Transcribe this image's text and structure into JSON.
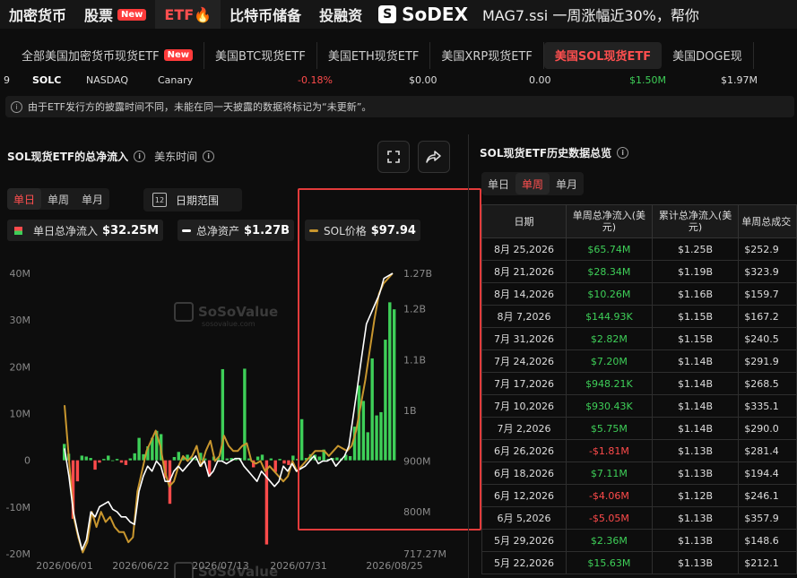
{
  "topnav": {
    "items": [
      {
        "label": "加密货币"
      },
      {
        "label": "股票",
        "badge": "New"
      },
      {
        "label": "ETF🔥",
        "active": true
      },
      {
        "label": "比特币储备"
      },
      {
        "label": "投融资"
      }
    ],
    "brand": "SoDEX",
    "ticker": "MAG7.ssi 一周涨幅近30%，帮你"
  },
  "subnav": {
    "tabs": [
      {
        "label": "全部美国加密货币现货ETF",
        "badge": "New"
      },
      {
        "label": "美国BTC现货ETF"
      },
      {
        "label": "美国ETH现货ETF"
      },
      {
        "label": "美国XRP现货ETF"
      },
      {
        "label": "美国SOL现货ETF",
        "active": true
      },
      {
        "label": "美国DOGE现"
      }
    ]
  },
  "etf_row": {
    "index": "9",
    "ticker": "SOLC",
    "exchange": "NASDAQ",
    "issuer": "Canary",
    "change": "-0.18%",
    "val1": "$0.00",
    "val2": "0.00",
    "val3": "$1.50M",
    "val4": "$1.97M"
  },
  "notice": "由于ETF发行方的披露时间不同，未能在同一天披露的数据将标记为“未更新”。",
  "left_panel": {
    "title": "SOL现货ETF的总净流入",
    "timezone": "美东时间",
    "period_tabs": [
      "单日",
      "单周",
      "单月"
    ],
    "active_period": "单日",
    "date_range_label": "日期范围",
    "calendar_day": "12",
    "legend": [
      {
        "label": "单日总净流入",
        "value": "$32.25M"
      },
      {
        "label": "总净资产",
        "value": "$1.27B"
      },
      {
        "label": "SOL价格",
        "value": "$97.94"
      }
    ],
    "watermark": "SoSoValue",
    "watermark_sub": "sosovalue.com"
  },
  "chart_data": {
    "type": "bar",
    "left_axis": {
      "ticks": [
        "40M",
        "30M",
        "20M",
        "10M",
        "0",
        "-10M",
        "-20M"
      ],
      "range": [
        -20,
        40
      ]
    },
    "right_axis": {
      "ticks": [
        "1.27B",
        "1.2B",
        "1.1B",
        "1B",
        "900M",
        "800M",
        "717.27M"
      ],
      "range": [
        717.27,
        1270
      ]
    },
    "x_labels": [
      "2026/06/01",
      "2026/06/22",
      "2026/07/13",
      "2026/07/31",
      "2026/08/25"
    ],
    "colors": {
      "positive": "#3ecf58",
      "negative": "#ff4b4b",
      "net_assets": "#ffffff",
      "sol_price": "#c8962e"
    },
    "series": [
      {
        "name": "单日总净流入",
        "values": [
          3.5,
          1.4,
          -12.5,
          -4.5,
          1.0,
          0.8,
          0.5,
          -2.0,
          -0.5,
          0.3,
          1.0,
          0.0,
          0.3,
          -0.5,
          -1.0,
          0.4,
          1.5,
          4.8,
          1.3,
          3.0,
          4.8,
          6.3,
          5.6,
          -3.8,
          -9.3,
          0.7,
          1.8,
          0.7,
          1.2,
          0.6,
          0.4,
          1.6,
          0.4,
          -3.4,
          0.8,
          0.6,
          19.5,
          0.4,
          0.5,
          0.2,
          0.5,
          19.6,
          0.4,
          -1.5,
          0.8,
          1.2,
          -18.0,
          0.4,
          -2.5,
          0.3,
          -0.7,
          -1.0,
          1.0,
          0.3,
          8.8,
          0.5,
          1.3,
          1.2,
          0.8,
          2.3,
          0.3,
          0.5,
          0.6,
          0.4,
          1.2,
          0.9,
          7.2,
          16.0,
          12.7,
          6.0,
          21.8,
          9.6,
          10.3,
          25.8,
          33.8,
          32.3
        ]
      },
      {
        "name": "总净资产",
        "values": [
          925,
          870,
          800,
          760,
          725,
          745,
          800,
          790,
          810,
          815,
          820,
          805,
          800,
          790,
          790,
          780,
          775,
          840,
          870,
          890,
          880,
          900,
          890,
          860,
          860,
          880,
          890,
          880,
          890,
          900,
          910,
          890,
          900,
          870,
          880,
          900,
          900,
          895,
          900,
          905,
          905,
          890,
          880,
          870,
          860,
          880,
          870,
          860,
          850,
          860,
          890,
          880,
          895,
          880,
          885,
          890,
          900,
          910,
          895,
          900,
          900,
          905,
          890,
          900,
          910,
          930,
          990,
          1050,
          1110,
          1170,
          1190,
          1210,
          1230,
          1260,
          1265,
          1270
        ]
      },
      {
        "name": "SOL价格",
        "values": [
          1010,
          900,
          790,
          750,
          720,
          740,
          800,
          770,
          800,
          780,
          790,
          770,
          760,
          760,
          740,
          750,
          840,
          880,
          920,
          940,
          960,
          930,
          880,
          850,
          860,
          890,
          910,
          900,
          910,
          930,
          890,
          920,
          940,
          900,
          910,
          950,
          930,
          920,
          920,
          930,
          935,
          900,
          895,
          900,
          880,
          890,
          880,
          870,
          860,
          870,
          900,
          880,
          890,
          900,
          910,
          920,
          920,
          920,
          910,
          920,
          930,
          925,
          920,
          930,
          960,
          1010,
          1060,
          1120,
          1180,
          1230,
          1250,
          1260,
          1270
        ]
      }
    ]
  },
  "right_panel": {
    "title": "SOL现货ETF历史数据总览",
    "period_tabs": [
      "单日",
      "单周",
      "单月"
    ],
    "active_period": "单周",
    "columns": [
      "日期",
      "单周总净流入(美元)",
      "累计总净流入(美元)",
      "单周总成交"
    ],
    "rows": [
      {
        "date": "8月 25,2026",
        "flow": "$65.74M",
        "cum": "$1.25B",
        "vol": "$252.9",
        "dir": "pos"
      },
      {
        "date": "8月 21,2026",
        "flow": "$28.34M",
        "cum": "$1.19B",
        "vol": "$323.9",
        "dir": "pos"
      },
      {
        "date": "8月 14,2026",
        "flow": "$10.26M",
        "cum": "$1.16B",
        "vol": "$159.7",
        "dir": "pos"
      },
      {
        "date": "8月 7,2026",
        "flow": "$144.93K",
        "cum": "$1.15B",
        "vol": "$167.2",
        "dir": "pos"
      },
      {
        "date": "7月 31,2026",
        "flow": "$2.82M",
        "cum": "$1.15B",
        "vol": "$240.5",
        "dir": "pos"
      },
      {
        "date": "7月 24,2026",
        "flow": "$7.20M",
        "cum": "$1.14B",
        "vol": "$291.9",
        "dir": "pos"
      },
      {
        "date": "7月 17,2026",
        "flow": "$948.21K",
        "cum": "$1.14B",
        "vol": "$268.5",
        "dir": "pos"
      },
      {
        "date": "7月 10,2026",
        "flow": "$930.43K",
        "cum": "$1.14B",
        "vol": "$335.1",
        "dir": "pos"
      },
      {
        "date": "7月 2,2026",
        "flow": "$5.75M",
        "cum": "$1.14B",
        "vol": "$290.0",
        "dir": "pos"
      },
      {
        "date": "6月 26,2026",
        "flow": "-$1.81M",
        "cum": "$1.13B",
        "vol": "$281.4",
        "dir": "neg"
      },
      {
        "date": "6月 18,2026",
        "flow": "$7.11M",
        "cum": "$1.13B",
        "vol": "$194.4",
        "dir": "pos"
      },
      {
        "date": "6月 12,2026",
        "flow": "-$4.06M",
        "cum": "$1.12B",
        "vol": "$246.1",
        "dir": "neg"
      },
      {
        "date": "6月 5,2026",
        "flow": "-$5.05M",
        "cum": "$1.13B",
        "vol": "$357.9",
        "dir": "neg"
      },
      {
        "date": "5月 29,2026",
        "flow": "$2.36M",
        "cum": "$1.13B",
        "vol": "$148.6",
        "dir": "pos"
      },
      {
        "date": "5月 22,2026",
        "flow": "$15.63M",
        "cum": "$1.13B",
        "vol": "$212.1",
        "dir": "pos"
      }
    ]
  }
}
